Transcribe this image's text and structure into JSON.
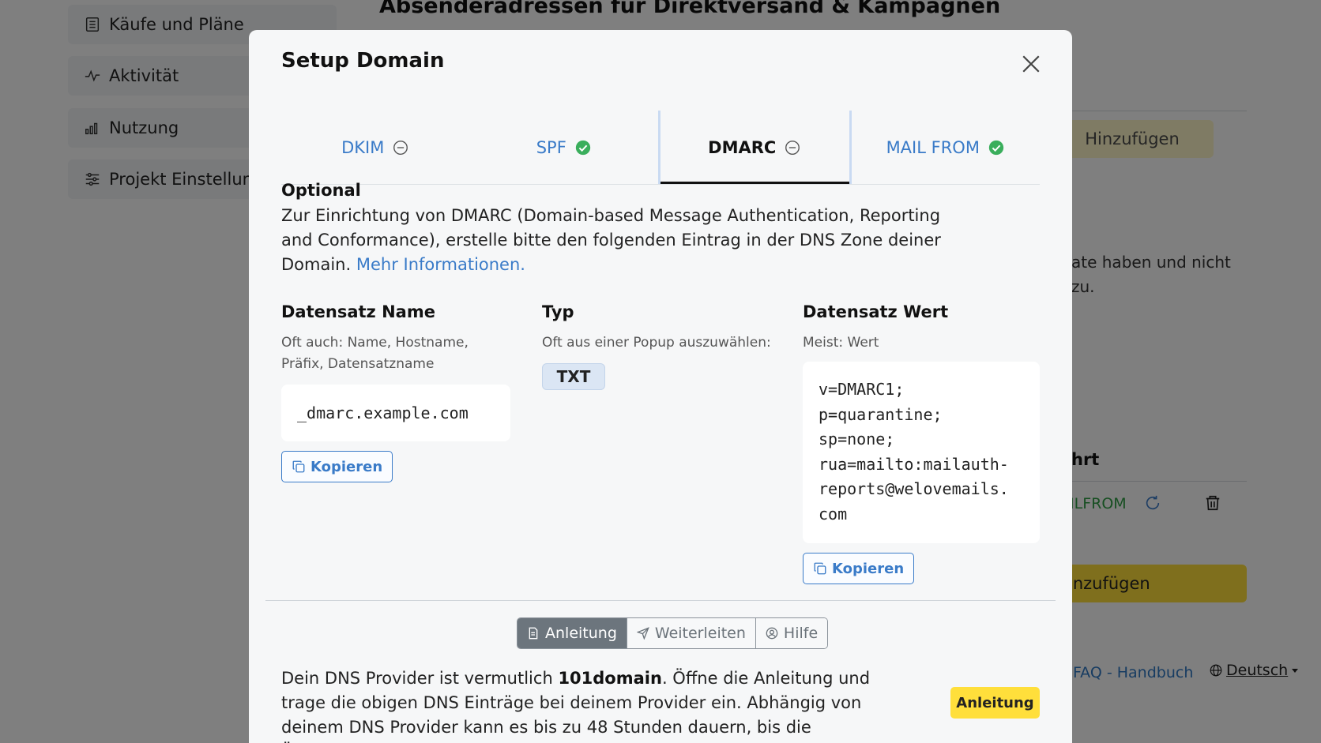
{
  "background": {
    "sidebar": [
      {
        "label": "Käufe und Pläne",
        "icon": "list-icon"
      },
      {
        "label": "Aktivität",
        "icon": "activity-icon"
      },
      {
        "label": "Nutzung",
        "icon": "bar-chart-icon"
      },
      {
        "label": "Projekt Einstellungen",
        "icon": "sliders-icon"
      }
    ],
    "page_title": "Absenderadressen für Direktversand & Kampagnen",
    "add_button_top": "Hinzufügen",
    "info_line1": "ate haben und nicht",
    "info_line2": "zu.",
    "column_header": "hrt",
    "record_status": "ILFROM",
    "add_button_bottom": "inzufügen",
    "faq_link": "FAQ - Handbuch",
    "language": "Deutsch"
  },
  "modal": {
    "title": "Setup Domain",
    "tabs": [
      {
        "label": "DKIM",
        "status": "pending"
      },
      {
        "label": "SPF",
        "status": "ok"
      },
      {
        "label": "DMARC",
        "status": "pending",
        "active": true
      },
      {
        "label": "MAIL FROM",
        "status": "ok"
      }
    ],
    "section_heading": "Optional",
    "intro_text": "Zur Einrichtung von DMARC (Domain-based Message Authentication, Reporting and Conformance), erstelle bitte den folgenden Eintrag in der DNS Zone deiner Domain. ",
    "intro_link": "Mehr Informationen.",
    "record_name": {
      "title": "Datensatz Name",
      "hint": "Oft auch: Name, Hostname, Präfix, Datensatzname",
      "value": "_dmarc.example.com",
      "copy_label": "Kopieren"
    },
    "record_type": {
      "title": "Typ",
      "hint": "Oft aus einer Popup auszuwählen:",
      "value": "TXT"
    },
    "record_value": {
      "title": "Datensatz Wert",
      "hint": "Meist: Wert",
      "lines": [
        "v=DMARC1;",
        "p=quarantine;",
        "sp=none;",
        "rua=mailto:mailauth-",
        "reports@welovemails.",
        "com"
      ],
      "copy_label": "Kopieren"
    },
    "segmented": [
      {
        "label": "Anleitung",
        "icon": "document-icon",
        "active": true
      },
      {
        "label": "Weiterleiten",
        "icon": "send-icon"
      },
      {
        "label": "Hilfe",
        "icon": "user-circle-icon"
      }
    ],
    "provider_text_before": "Dein DNS Provider ist vermutlich ",
    "provider_name": "101domain",
    "provider_text_after": ". Öffne die Anleitung und trage die obigen DNS Einträge bei deinem Provider ein. Abhängig von deinem DNS Provider kann es bis zu 48 Stunden dauern, bis die Änderungen in Kraft treten.",
    "guide_button": "Anleitung"
  },
  "colors": {
    "link": "#3a7bc8",
    "success": "#3aae5c",
    "accent_yellow": "#ffdf3b",
    "overlay": "rgba(0,0,0,0.5)"
  }
}
